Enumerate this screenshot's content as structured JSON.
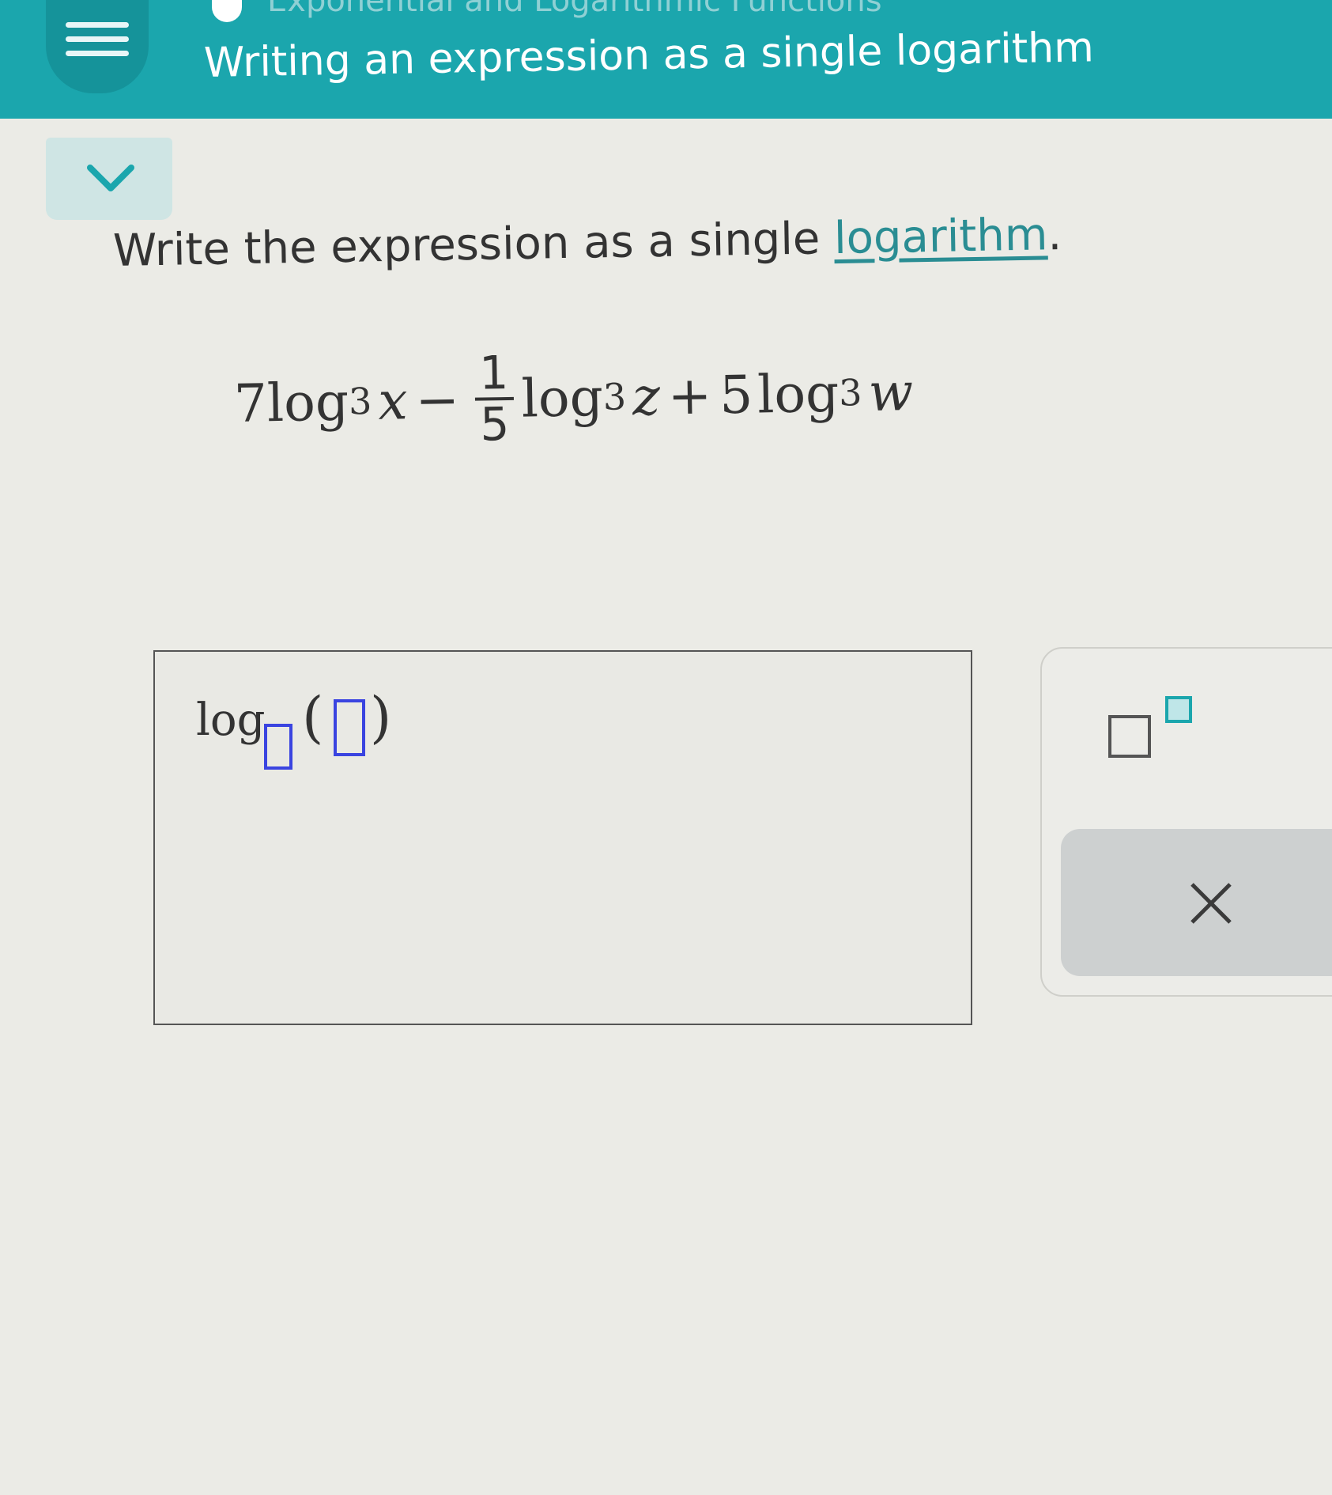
{
  "header": {
    "topic": "Exponential and Logarithmic Functions",
    "title": "Writing an expression as a single logarithm",
    "menu_icon": "hamburger-menu-icon",
    "collapse_icon": "chevron-down-icon"
  },
  "problem": {
    "prompt_before": "Write the expression as a single ",
    "prompt_link": "logarithm",
    "prompt_after": ".",
    "expression": {
      "coef1": "7",
      "log1": "log",
      "base1": "3",
      "var1": "x",
      "op1": "−",
      "frac_num": "1",
      "frac_den": "5",
      "log2": "log",
      "base2": "3",
      "var2": "z",
      "op2": "+",
      "coef3": "5",
      "log3": "log",
      "base3": "3",
      "var3": "w"
    }
  },
  "answer": {
    "log_label": "log",
    "open_paren": "(",
    "close_paren": ")"
  },
  "keypad": {
    "exponent_icon": "exponent-template-icon",
    "clear_icon": "close-x-icon"
  },
  "colors": {
    "header_teal": "#1ba6ad",
    "link_teal": "#2a8d93",
    "slot_blue": "#3a44e0",
    "page_bg": "#ebebe6"
  }
}
